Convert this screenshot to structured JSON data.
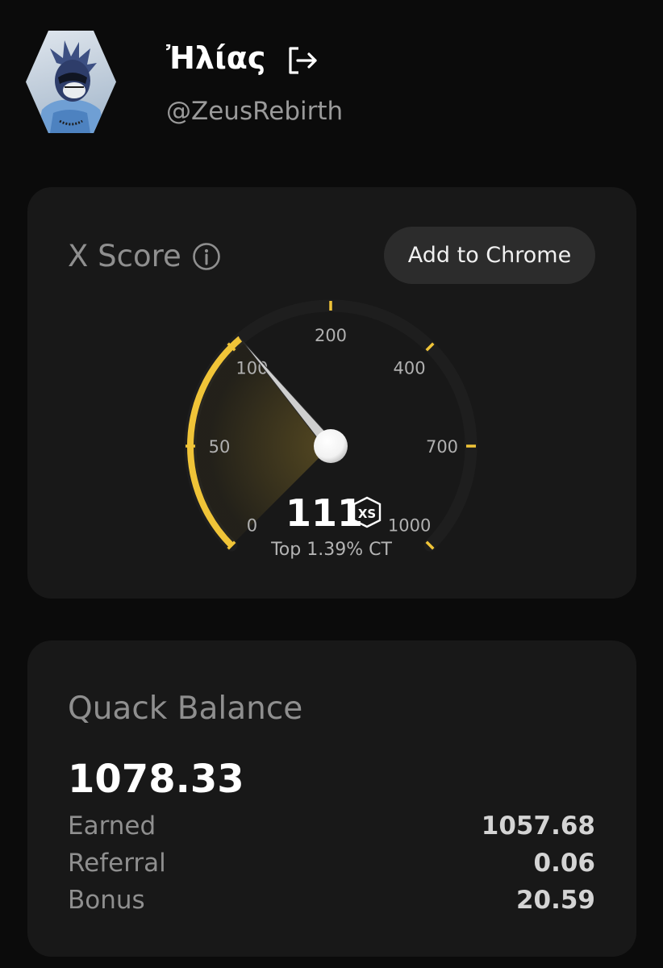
{
  "profile": {
    "display_name": "Ἠλίας",
    "handle": "@ZeusRebirth",
    "avatar_icon": "avatar-masked-figure",
    "logout_icon": "logout-icon"
  },
  "xscore": {
    "title": "X Score",
    "info_icon": "info-icon",
    "add_button_label": "Add to Chrome",
    "score": "111",
    "score_value": 111,
    "badge_icon": "xs-logo-icon",
    "subtitle": "Top 1.39% CT",
    "gauge": {
      "scale_labels": [
        "0",
        "50",
        "100",
        "200",
        "400",
        "700",
        "1000"
      ],
      "accent_color": "#f0c438",
      "track_color": "#1e1e1e"
    }
  },
  "balance": {
    "title": "Quack Balance",
    "total": "1078.33",
    "rows": [
      {
        "label": "Earned",
        "value": "1057.68"
      },
      {
        "label": "Referral",
        "value": "0.06"
      },
      {
        "label": "Bonus",
        "value": "20.59"
      }
    ]
  }
}
